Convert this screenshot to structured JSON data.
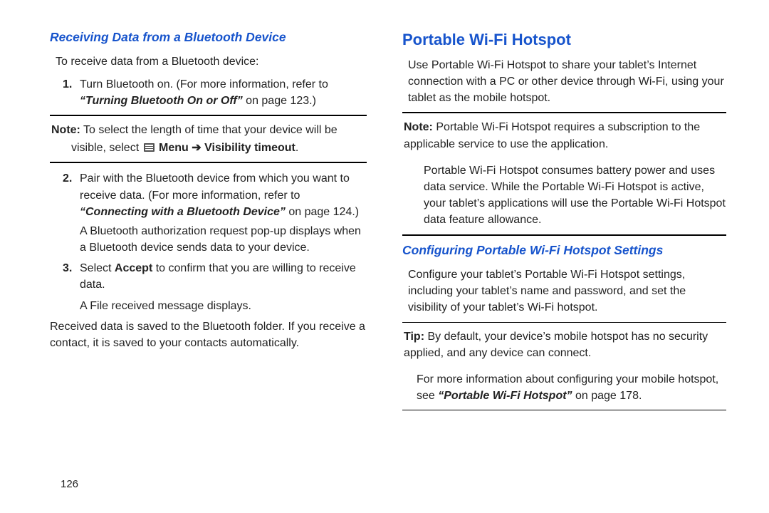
{
  "left": {
    "heading": "Receiving Data from a Bluetooth Device",
    "intro": "To receive data from a Bluetooth device:",
    "step1_a": "Turn Bluetooth on. (For more information, refer to ",
    "step1_ref": "“Turning Bluetooth On or Off”",
    "step1_b": " on page 123.)",
    "note1_label": "Note:",
    "note1_a": " To select the length of time that your device will be",
    "note1_b": "visible, select ",
    "note1_menu": "Menu",
    "note1_arrow": " ➔ ",
    "note1_vt": "Visibility timeout",
    "note1_end": ".",
    "step2_a": "Pair with the Bluetooth device from which you want to receive data. (For more information, refer to ",
    "step2_ref": "“Connecting with a Bluetooth Device”",
    "step2_b": " on page 124.)",
    "step2_c": "A Bluetooth authorization request pop-up displays when a Bluetooth device sends data to your device.",
    "step3_a": "Select ",
    "step3_accept": "Accept",
    "step3_b": " to confirm that you are willing to receive data.",
    "step3_c": "A File received message displays.",
    "outro": "Received data is saved to the Bluetooth folder. If you receive a contact, it is saved to your contacts automatically."
  },
  "right": {
    "title": "Portable Wi-Fi Hotspot",
    "p1": "Use Portable Wi-Fi Hotspot to share your tablet’s Internet connection with a PC or other device through Wi-Fi, using your tablet as the mobile hotspot.",
    "note_label": "Note:",
    "note_a": " Portable Wi-Fi Hotspot requires a subscription to the applicable service to use the application.",
    "note_b": "Portable Wi-Fi Hotspot consumes battery power and uses data service. While the Portable Wi-Fi Hotspot is active, your tablet’s applications will use the Portable Wi-Fi Hotspot data feature allowance.",
    "sub": "Configuring Portable Wi-Fi Hotspot Settings",
    "p2": "Configure your tablet’s Portable Wi-Fi Hotspot settings, including your tablet’s name and password, and set the visibility of your tablet’s Wi-Fi hotspot.",
    "tip_label": "Tip:",
    "tip_a": " By default, your device’s mobile hotspot has no security applied, and any device can connect.",
    "tip_b_a": "For more information about configuring your mobile hotspot, see ",
    "tip_b_ref": "“Portable Wi-Fi Hotspot”",
    "tip_b_b": " on page 178."
  },
  "pageNumber": "126",
  "numbers": {
    "n1": "1.",
    "n2": "2.",
    "n3": "3."
  }
}
